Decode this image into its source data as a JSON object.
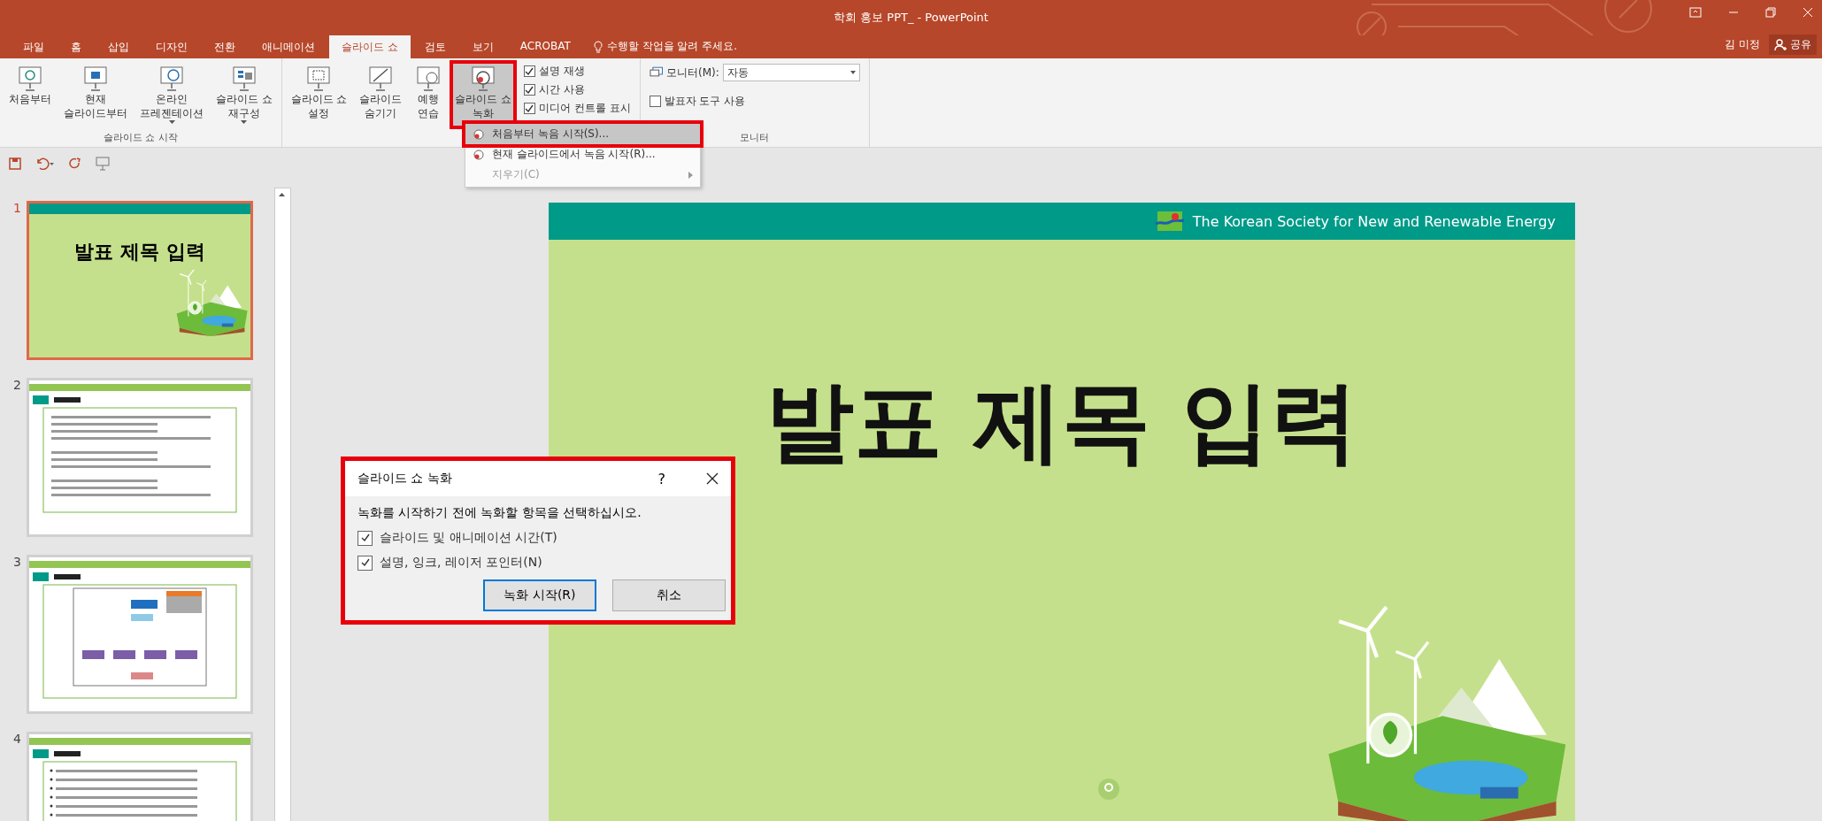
{
  "window": {
    "title": "학회 홍보 PPT_ - PowerPoint",
    "user": "김 미정",
    "share": "공유"
  },
  "tabs": [
    {
      "label": "파일",
      "selected": false
    },
    {
      "label": "홈",
      "selected": false
    },
    {
      "label": "삽입",
      "selected": false
    },
    {
      "label": "디자인",
      "selected": false
    },
    {
      "label": "전환",
      "selected": false
    },
    {
      "label": "애니메이션",
      "selected": false
    },
    {
      "label": "슬라이드 쇼",
      "selected": true
    },
    {
      "label": "검토",
      "selected": false
    },
    {
      "label": "보기",
      "selected": false
    },
    {
      "label": "ACROBAT",
      "selected": false
    }
  ],
  "tell_me": "수행할 작업을 알려 주세요.",
  "ribbon": {
    "groups": [
      {
        "label": "슬라이드 쇼 시작",
        "buttons": [
          {
            "lines": [
              "처음부터"
            ],
            "dropdown": false,
            "pressed": false,
            "highlighted": false
          },
          {
            "lines": [
              "현재",
              "슬라이드부터"
            ],
            "dropdown": false,
            "pressed": false,
            "highlighted": false
          },
          {
            "lines": [
              "온라인",
              "프레젠테이션"
            ],
            "dropdown": true,
            "pressed": false,
            "highlighted": false
          },
          {
            "lines": [
              "슬라이드 쇼",
              "재구성"
            ],
            "dropdown": true,
            "pressed": false,
            "highlighted": false
          }
        ]
      },
      {
        "buttons": [
          {
            "lines": [
              "슬라이드 쇼",
              "설정"
            ],
            "dropdown": false,
            "pressed": false,
            "highlighted": false
          },
          {
            "lines": [
              "슬라이드",
              "숨기기"
            ],
            "dropdown": false,
            "pressed": false,
            "highlighted": false
          },
          {
            "lines": [
              "예행",
              "연습"
            ],
            "dropdown": false,
            "pressed": false,
            "highlighted": false
          },
          {
            "lines": [
              "슬라이드 쇼",
              "녹화"
            ],
            "dropdown": true,
            "pressed": true,
            "highlighted": true
          }
        ],
        "checkboxes": [
          {
            "label": "설명 재생",
            "checked": true
          },
          {
            "label": "시간 사용",
            "checked": true
          },
          {
            "label": "미디어 컨트롤 표시",
            "checked": true
          }
        ]
      },
      {
        "label": "모니터",
        "monitor": {
          "label": "모니터(M):",
          "value": "자동"
        },
        "checkboxes": [
          {
            "label": "발표자 도구 사용",
            "checked": false
          }
        ]
      }
    ]
  },
  "recording_menu": {
    "items": [
      {
        "label": "처음부터 녹음 시작(S)...",
        "selected": true,
        "highlighted": true,
        "submenu": false,
        "disabled": false
      },
      {
        "label": "현재 슬라이드에서 녹음 시작(R)...",
        "selected": false,
        "highlighted": false,
        "submenu": false,
        "disabled": false
      },
      {
        "label": "지우기(C)",
        "selected": false,
        "highlighted": false,
        "submenu": true,
        "disabled": true
      }
    ]
  },
  "slides": [
    {
      "number": "1",
      "selected": true,
      "kind": "title",
      "title": "발표 제목 입력"
    },
    {
      "number": "2",
      "selected": false,
      "kind": "text"
    },
    {
      "number": "3",
      "selected": false,
      "kind": "chart"
    },
    {
      "number": "4",
      "selected": false,
      "kind": "list"
    }
  ],
  "slide": {
    "header": "The Korean Society for New and Renewable Energy",
    "title": "발표 제목 입력"
  },
  "dialog": {
    "title": "슬라이드 쇼 녹화",
    "help": "?",
    "highlighted": true,
    "prompt": "녹화를 시작하기 전에 녹화할 항목을 선택하십시오.",
    "options": [
      {
        "label": "슬라이드 및 애니메이션 시간(T)",
        "checked": true
      },
      {
        "label": "설명, 잉크, 레이저 포인터(N)",
        "checked": true
      }
    ],
    "buttons": [
      {
        "label": "녹화 시작(R)",
        "default": true
      },
      {
        "label": "취소",
        "default": false
      }
    ]
  }
}
